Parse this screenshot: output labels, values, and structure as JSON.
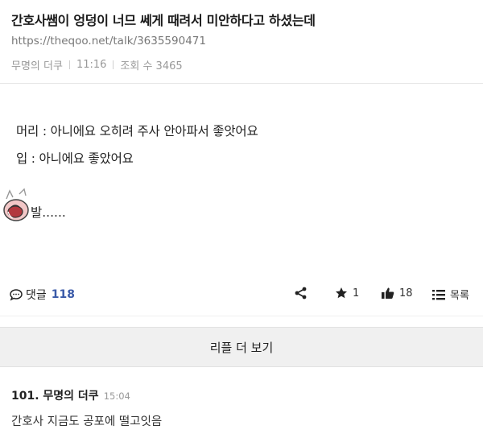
{
  "post": {
    "title": "간호사쌤이 엉덩이 너므 쎄게 때려서 미안하다고 하셨는데",
    "url": "https://theqoo.net/talk/3635590471",
    "author": "무명의 더쿠",
    "time": "11:16",
    "views_label": "조회 수 3465"
  },
  "content": {
    "line1": "머리 : 아니에요 오히려 주사 안아파서 좋앗어요",
    "line2": "입 : 아니에요 좋았어요",
    "line3": "발......"
  },
  "actions": {
    "comment_label": "댓글",
    "comment_count": "118",
    "star_count": "1",
    "like_count": "18",
    "list_label": "목록"
  },
  "more_replies_label": "리플 더 보기",
  "reply": {
    "number_author": "101. 무명의 더쿠",
    "time": "15:04",
    "text": "간호사 지금도 공포에 떨고잇음"
  }
}
